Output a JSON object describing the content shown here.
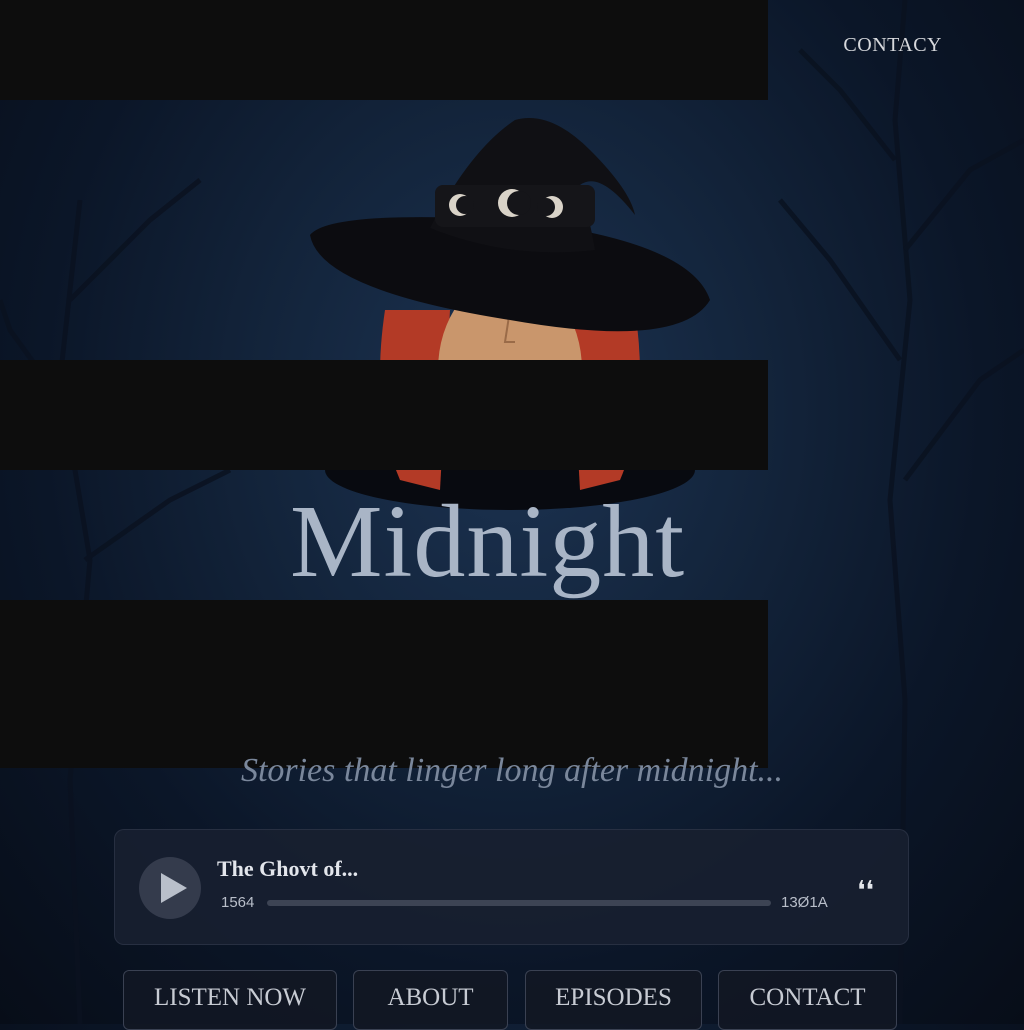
{
  "header": {
    "contact_link": "CONTACY"
  },
  "hero": {
    "title": "Midnight",
    "tagline": "Stories that linger long after midnight..."
  },
  "player": {
    "episode_title": "The Ghovt of...",
    "time_elapsed": "1564",
    "time_total": "13Ø1A",
    "progress": 0,
    "volume_icon": "speaker-icon"
  },
  "nav": {
    "items": [
      {
        "label": "LISTEN NOW"
      },
      {
        "label": "ABOUT"
      },
      {
        "label": "EPISODES"
      },
      {
        "label": "CONTACT"
      }
    ]
  },
  "colors": {
    "background": "#0b1628",
    "redaction": "#0d0d0d",
    "title": "#a9b5c6",
    "player_bg": "#181f30"
  }
}
